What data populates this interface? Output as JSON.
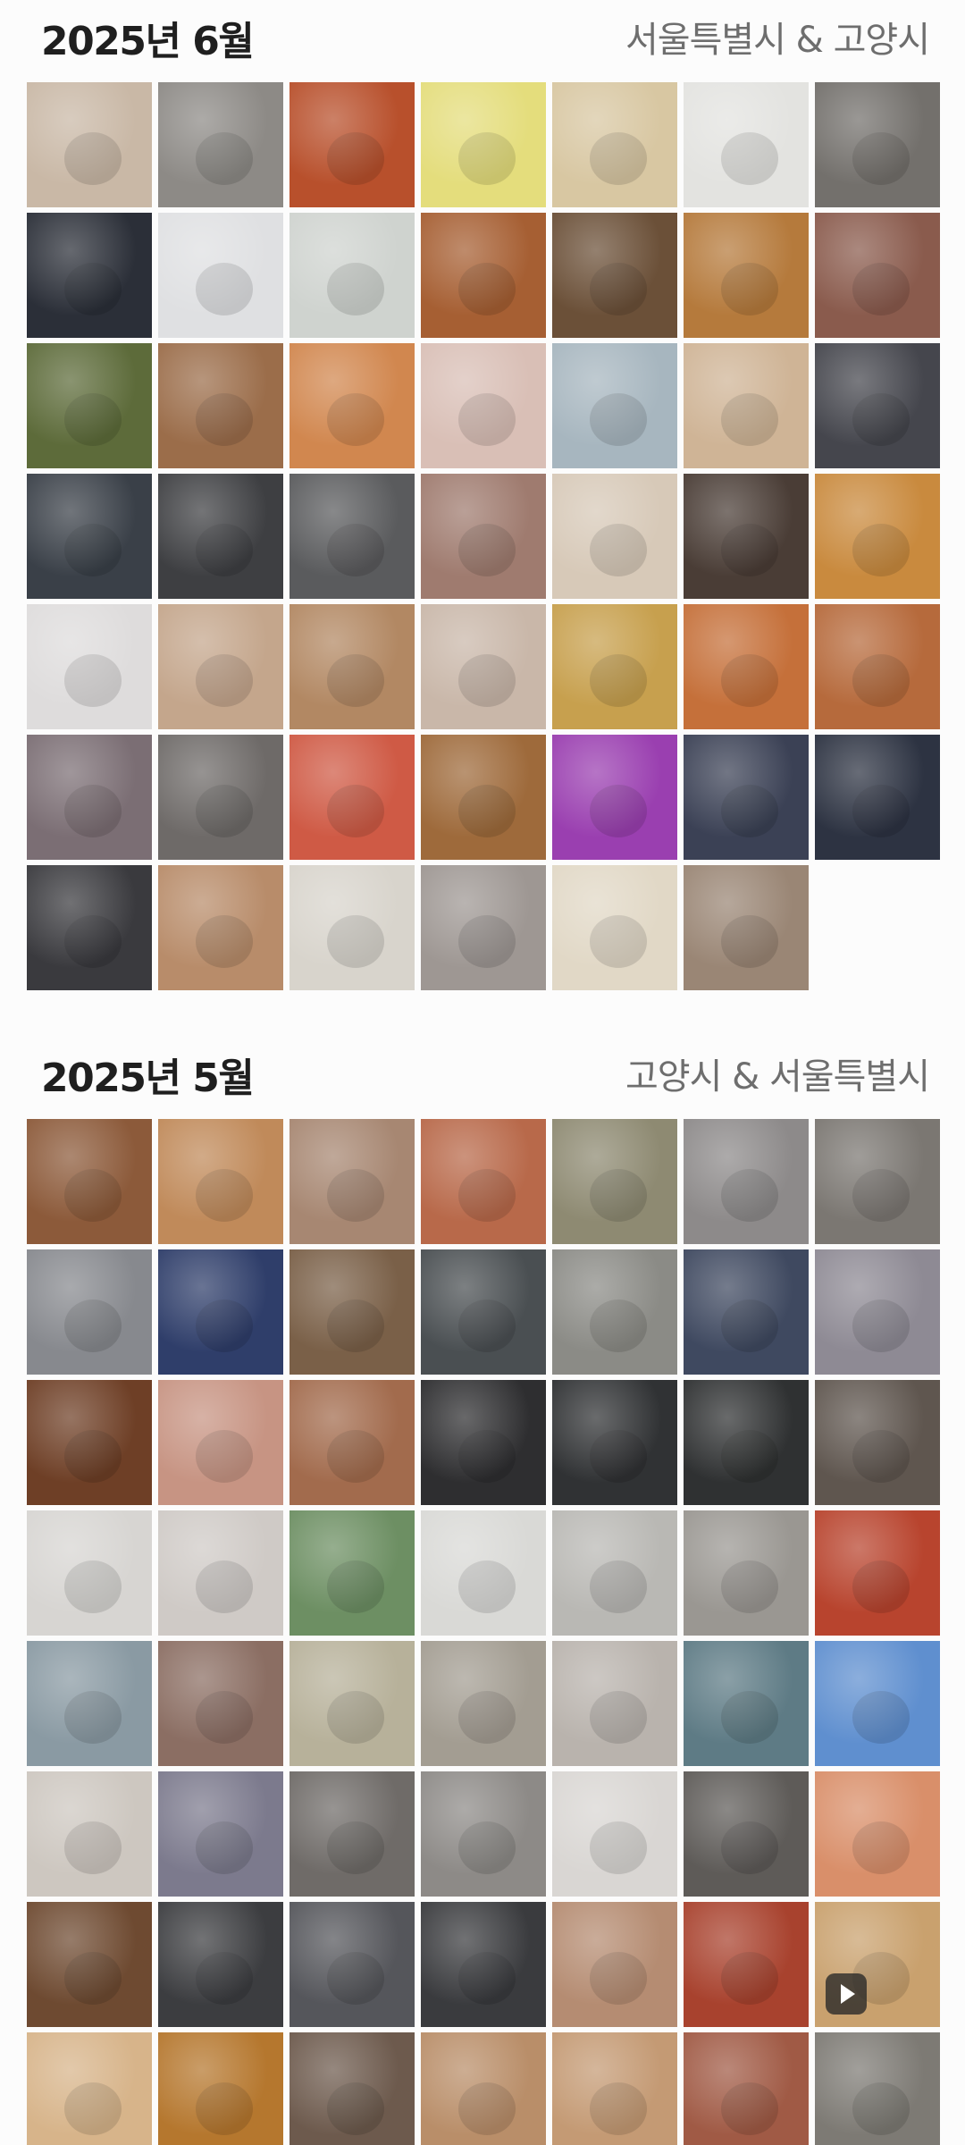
{
  "sections": [
    {
      "title": "2025년 6월",
      "location": "서울특별시 & 고양시",
      "photos": [
        {
          "color": "#c9b8a6",
          "video": false
        },
        {
          "color": "#8d8a86",
          "video": false
        },
        {
          "color": "#b8502c",
          "video": false
        },
        {
          "color": "#e4dd7c",
          "video": false
        },
        {
          "color": "#d8c7a2",
          "video": false
        },
        {
          "color": "#e3e3e0",
          "video": false
        },
        {
          "color": "#73706c",
          "video": false
        },
        {
          "color": "#2b2f38",
          "video": false
        },
        {
          "color": "#dfe0e2",
          "video": false
        },
        {
          "color": "#cfd3cf",
          "video": false
        },
        {
          "color": "#a65f33",
          "video": false
        },
        {
          "color": "#6b5038",
          "video": false
        },
        {
          "color": "#b57a3c",
          "video": false
        },
        {
          "color": "#8a5b4d",
          "video": false
        },
        {
          "color": "#5d6b3a",
          "video": false
        },
        {
          "color": "#9b6d4a",
          "video": false
        },
        {
          "color": "#d1874f",
          "video": false
        },
        {
          "color": "#d9bfb6",
          "video": false
        },
        {
          "color": "#a7b6bf",
          "video": false
        },
        {
          "color": "#cfb496",
          "video": false
        },
        {
          "color": "#45464d",
          "video": false
        },
        {
          "color": "#3a4048",
          "video": false
        },
        {
          "color": "#3e3f42",
          "video": false
        },
        {
          "color": "#5a5b5d",
          "video": false
        },
        {
          "color": "#9f7b6f",
          "video": false
        },
        {
          "color": "#d7c9b8",
          "video": false
        },
        {
          "color": "#4a3d36",
          "video": false
        },
        {
          "color": "#c98a3e",
          "video": false
        },
        {
          "color": "#dedcdc",
          "video": false
        },
        {
          "color": "#c4a68c",
          "video": false
        },
        {
          "color": "#b28863",
          "video": false
        },
        {
          "color": "#c9b7a9",
          "video": false
        },
        {
          "color": "#c7a04e",
          "video": false
        },
        {
          "color": "#c5703a",
          "video": false
        },
        {
          "color": "#b66a3c",
          "video": false
        },
        {
          "color": "#7b6e74",
          "video": false
        },
        {
          "color": "#6e6a68",
          "video": false
        },
        {
          "color": "#cf5a45",
          "video": false
        },
        {
          "color": "#9e6a3b",
          "video": false
        },
        {
          "color": "#9a3fb0",
          "video": false
        },
        {
          "color": "#3b4155",
          "video": false
        },
        {
          "color": "#2d3342",
          "video": false
        },
        {
          "color": "#3a3a3e",
          "video": false
        },
        {
          "color": "#b88c6a",
          "video": false
        },
        {
          "color": "#d8d4cc",
          "video": false
        },
        {
          "color": "#9e9793",
          "video": false
        },
        {
          "color": "#e1d8c6",
          "video": false
        },
        {
          "color": "#9a8675",
          "video": false
        }
      ]
    },
    {
      "title": "2025년 5월",
      "location": "고양시 & 서울특별시",
      "photos": [
        {
          "color": "#8c5a3a",
          "video": false
        },
        {
          "color": "#c08a5a",
          "video": false
        },
        {
          "color": "#a78772",
          "video": false
        },
        {
          "color": "#b8694a",
          "video": false
        },
        {
          "color": "#8e8a72",
          "video": false
        },
        {
          "color": "#8d8a8a",
          "video": false
        },
        {
          "color": "#7b7772",
          "video": false
        },
        {
          "color": "#87898e",
          "video": false
        },
        {
          "color": "#2f3e6a",
          "video": false
        },
        {
          "color": "#7a6048",
          "video": false
        },
        {
          "color": "#4a4f52",
          "video": false
        },
        {
          "color": "#8b8b86",
          "video": false
        },
        {
          "color": "#3f4960",
          "video": false
        },
        {
          "color": "#8e8a94",
          "video": false
        },
        {
          "color": "#6e3f26",
          "video": false
        },
        {
          "color": "#c79483",
          "video": false
        },
        {
          "color": "#a26b4d",
          "video": false
        },
        {
          "color": "#2e2e30",
          "video": false
        },
        {
          "color": "#303234",
          "video": false
        },
        {
          "color": "#2f3132",
          "video": false
        },
        {
          "color": "#5f564f",
          "video": false
        },
        {
          "color": "#d7d5d2",
          "video": false
        },
        {
          "color": "#cfcac6",
          "video": false
        },
        {
          "color": "#6d8f63",
          "video": false
        },
        {
          "color": "#d9d9d6",
          "video": false
        },
        {
          "color": "#b9b8b4",
          "video": false
        },
        {
          "color": "#9a9792",
          "video": false
        },
        {
          "color": "#b8442e",
          "video": false
        },
        {
          "color": "#8a9aa3",
          "video": false
        },
        {
          "color": "#8b6e63",
          "video": false
        },
        {
          "color": "#b7b19a",
          "video": false
        },
        {
          "color": "#a39d92",
          "video": false
        },
        {
          "color": "#b9b3ad",
          "video": false
        },
        {
          "color": "#5e7b85",
          "video": false
        },
        {
          "color": "#5f8fcf",
          "video": false
        },
        {
          "color": "#cdc7c0",
          "video": false
        },
        {
          "color": "#7c7a8d",
          "video": false
        },
        {
          "color": "#6f6b68",
          "video": false
        },
        {
          "color": "#8d8a87",
          "video": false
        },
        {
          "color": "#d9d6d3",
          "video": false
        },
        {
          "color": "#5e5b58",
          "video": false
        },
        {
          "color": "#d98f6a",
          "video": false
        },
        {
          "color": "#6e4a31",
          "video": false
        },
        {
          "color": "#3c3d40",
          "video": false
        },
        {
          "color": "#55565b",
          "video": false
        },
        {
          "color": "#3a3b3e",
          "video": false
        },
        {
          "color": "#b58c72",
          "video": false
        },
        {
          "color": "#a8422e",
          "video": false
        },
        {
          "color": "#c9a16e",
          "video": true
        },
        {
          "color": "#d7b48a",
          "video": false
        },
        {
          "color": "#b5772e",
          "video": false
        },
        {
          "color": "#6d5a4d",
          "video": false
        },
        {
          "color": "#b98e69",
          "video": false
        },
        {
          "color": "#c49a74",
          "video": false
        },
        {
          "color": "#a05a45",
          "video": false
        },
        {
          "color": "#7d7a74",
          "video": false
        }
      ]
    }
  ]
}
